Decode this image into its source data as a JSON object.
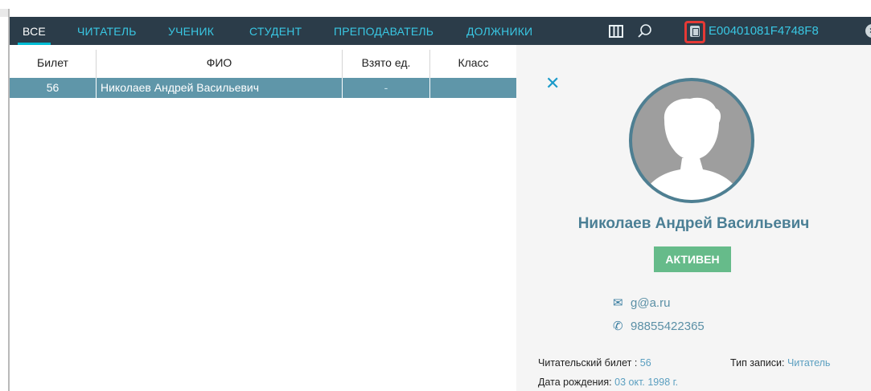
{
  "nav": {
    "tabs": [
      {
        "label": "ВСЕ",
        "active": true
      },
      {
        "label": "ЧИТАТЕЛЬ"
      },
      {
        "label": "УЧЕНИК"
      },
      {
        "label": "СТУДЕНТ"
      },
      {
        "label": "ПРЕПОДАВАТЕЛЬ"
      },
      {
        "label": "ДОЛЖНИКИ"
      }
    ],
    "rfid_code": "E00401081F4748F8",
    "colors": {
      "bar": "#2b3c49",
      "accent": "#39c7e3",
      "highlight": "#e53935"
    }
  },
  "table": {
    "headers": [
      "Билет",
      "ФИО",
      "Взято ед.",
      "Класс"
    ],
    "rows": [
      {
        "ticket": "56",
        "name": "Николаев Андрей Васильевич",
        "taken": "-",
        "class": ""
      }
    ]
  },
  "profile": {
    "name": "Николаев Андрей Васильевич",
    "status": "АКТИВЕН",
    "email": "g@a.ru",
    "phone": "98855422365",
    "ticket_label": "Читательский билет : ",
    "ticket_value": "56",
    "type_label": "Тип записи: ",
    "type_value": "Читатель",
    "birth_label": "Дата рождения: ",
    "birth_value": "03 окт. 1998 г."
  }
}
